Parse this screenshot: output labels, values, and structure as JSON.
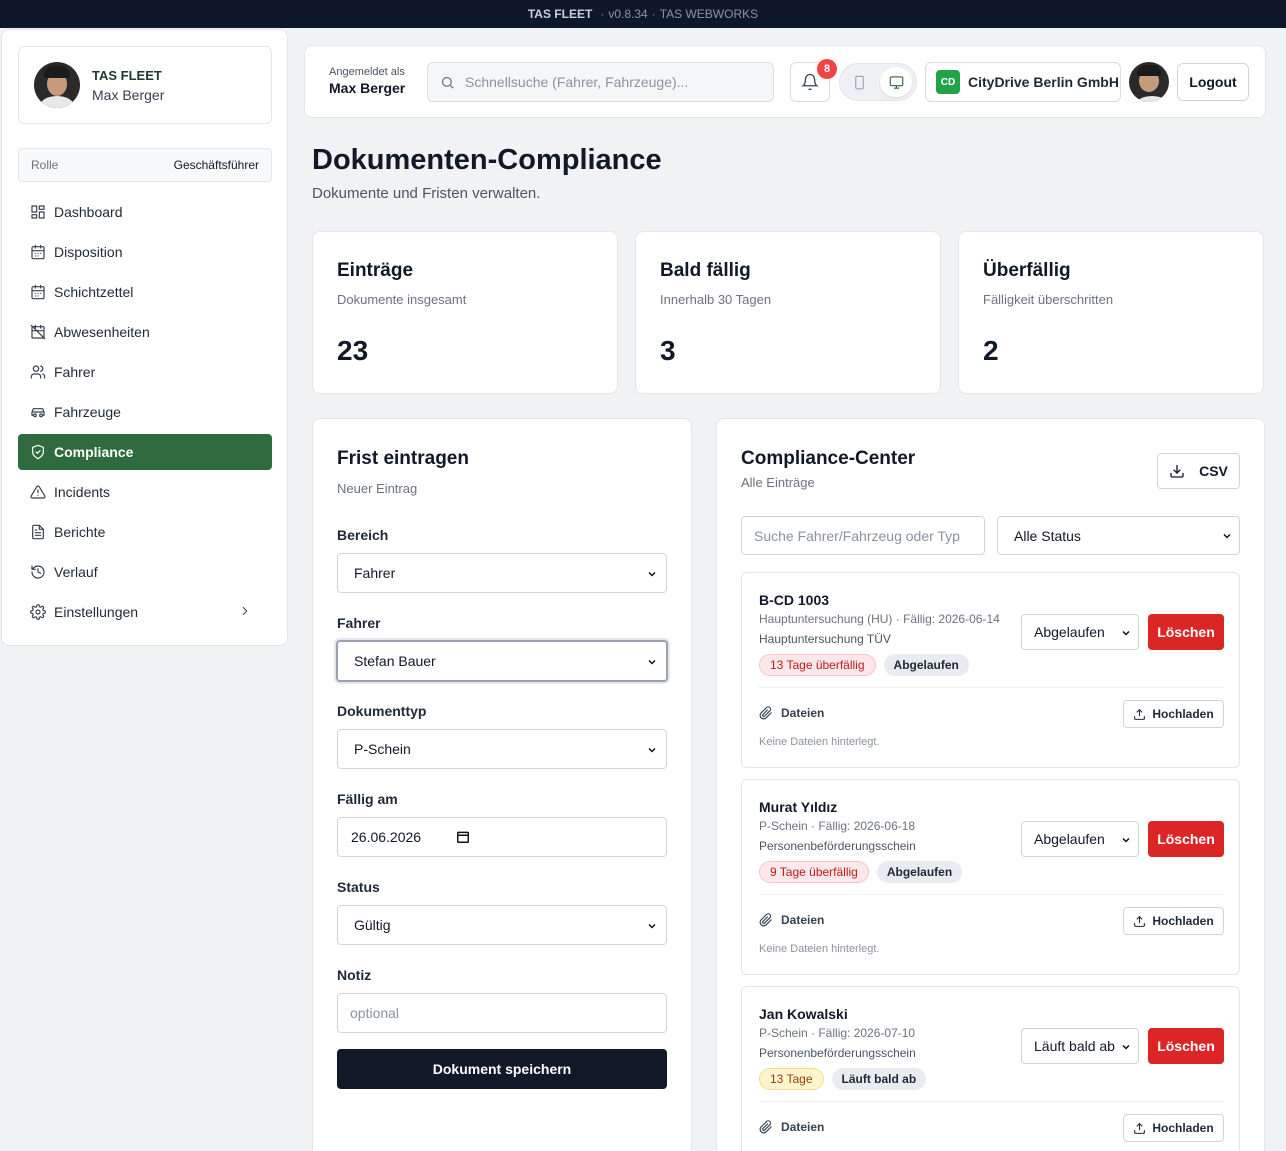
{
  "topbar": {
    "brand": "TAS FLEET",
    "version": "v0.8.34",
    "vendor": "TAS WEBWORKS"
  },
  "sidebar": {
    "org": "TAS FLEET",
    "user": "Max Berger",
    "role_label": "Rolle",
    "role_value": "Geschäftsführer",
    "items": [
      {
        "label": "Dashboard",
        "icon": "grid-icon"
      },
      {
        "label": "Disposition",
        "icon": "calendar-icon"
      },
      {
        "label": "Schichtzettel",
        "icon": "calendar-icon"
      },
      {
        "label": "Abwesenheiten",
        "icon": "calendar-off-icon"
      },
      {
        "label": "Fahrer",
        "icon": "users-icon"
      },
      {
        "label": "Fahrzeuge",
        "icon": "car-icon"
      },
      {
        "label": "Compliance",
        "icon": "shield-check-icon",
        "active": true
      },
      {
        "label": "Incidents",
        "icon": "alert-triangle-icon"
      },
      {
        "label": "Berichte",
        "icon": "file-text-icon"
      },
      {
        "label": "Verlauf",
        "icon": "history-icon"
      },
      {
        "label": "Einstellungen",
        "icon": "gear-icon"
      }
    ]
  },
  "header": {
    "logged_in_label": "Angemeldet als",
    "logged_in_user": "Max Berger",
    "search_placeholder": "Schnellsuche (Fahrer, Fahrzeuge)...",
    "notification_count": "8",
    "company_badge": "CD",
    "company_name": "CityDrive Berlin GmbH",
    "logout_label": "Logout"
  },
  "page": {
    "title": "Dokumenten-Compliance",
    "subtitle": "Dokumente und Fristen verwalten."
  },
  "stats": [
    {
      "title": "Einträge",
      "subtitle": "Dokumente insgesamt",
      "value": "23"
    },
    {
      "title": "Bald fällig",
      "subtitle": "Innerhalb 30 Tagen",
      "value": "3"
    },
    {
      "title": "Überfällig",
      "subtitle": "Fälligkeit überschritten",
      "value": "2"
    }
  ],
  "form": {
    "title": "Frist eintragen",
    "subtitle": "Neuer Eintrag",
    "bereich_label": "Bereich",
    "bereich_value": "Fahrer",
    "fahrer_label": "Fahrer",
    "fahrer_value": "Stefan Bauer",
    "doktyp_label": "Dokumenttyp",
    "doktyp_value": "P-Schein",
    "faellig_label": "Fällig am",
    "faellig_value": "26.06.2026",
    "status_label": "Status",
    "status_value": "Gültig",
    "notiz_label": "Notiz",
    "notiz_placeholder": "optional",
    "save_label": "Dokument speichern"
  },
  "compliance_center": {
    "title": "Compliance-Center",
    "subtitle": "Alle Einträge",
    "csv_label": "CSV",
    "search_placeholder": "Suche Fahrer/Fahrzeug oder Typ",
    "status_filter": "Alle Status",
    "files_label": "Dateien",
    "upload_label": "Hochladen",
    "delete_label": "Löschen",
    "no_files": "Keine Dateien hinterlegt.",
    "entries": [
      {
        "name": "B-CD 1003",
        "meta": "Hauptuntersuchung (HU) · Fällig: 2026-06-14",
        "desc": "Hauptuntersuchung TÜV",
        "days_tag": "13 Tage überfällig",
        "status_tag": "Abgelaufen",
        "status_select": "Abgelaufen"
      },
      {
        "name": "Murat Yıldız",
        "meta": "P-Schein · Fällig: 2026-06-18",
        "desc": "Personenbeförderungsschein",
        "days_tag": "9 Tage überfällig",
        "status_tag": "Abgelaufen",
        "status_select": "Abgelaufen"
      },
      {
        "name": "Jan Kowalski",
        "meta": "P-Schein · Fällig: 2026-07-10",
        "desc": "Personenbeförderungsschein",
        "days_tag": "13 Tage",
        "status_tag": "Läuft bald ab",
        "status_select": "Läuft bald ab"
      }
    ]
  },
  "colors": {
    "accent": "#2f6b3e",
    "danger": "#dc2626",
    "dark": "#111827",
    "badge": "#ef4444"
  }
}
